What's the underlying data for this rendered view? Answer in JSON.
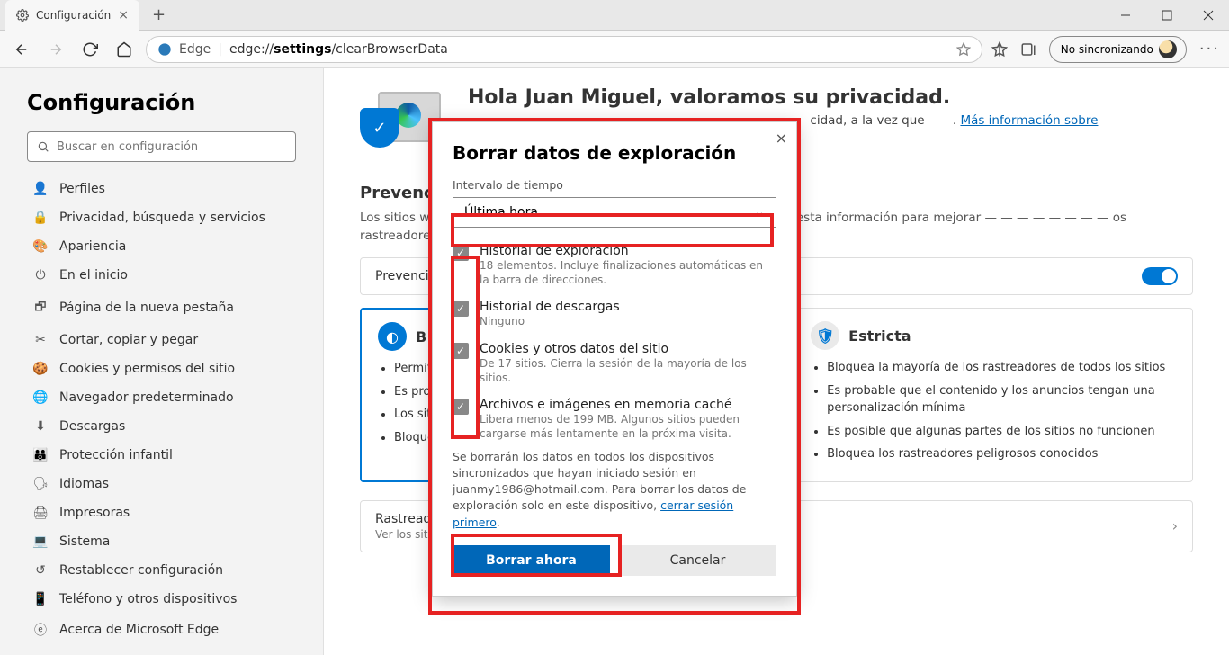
{
  "tab": {
    "title": "Configuración"
  },
  "toolbar": {
    "browser_label": "Edge",
    "url_prefix": "edge://",
    "url_mid": "settings",
    "url_rest": "/clearBrowserData",
    "sync_label": "No sincronizando"
  },
  "sidebar": {
    "title": "Configuración",
    "search_placeholder": "Buscar en configuración",
    "items": [
      {
        "label": "Perfiles"
      },
      {
        "label": "Privacidad, búsqueda y servicios"
      },
      {
        "label": "Apariencia"
      },
      {
        "label": "En el inicio"
      },
      {
        "label": "Página de la nueva pestaña"
      },
      {
        "label": "Cortar, copiar y pegar"
      },
      {
        "label": "Cookies y permisos del sitio"
      },
      {
        "label": "Navegador predeterminado"
      },
      {
        "label": "Descargas"
      },
      {
        "label": "Protección infantil"
      },
      {
        "label": "Idiomas"
      },
      {
        "label": "Impresoras"
      },
      {
        "label": "Sistema"
      },
      {
        "label": "Restablecer configuración"
      },
      {
        "label": "Teléfono y otros dispositivos"
      },
      {
        "label": "Acerca de Microsoft Edge"
      }
    ]
  },
  "main": {
    "hero_title": "Hola Juan Miguel, valoramos su privacidad.",
    "hero_sub_pre": "—— —— — ————— —— ———— —— ——— — ——— cidad, a la vez que",
    "hero_sub_link": "Más información sobre",
    "prevention_h": "Prevención",
    "prevention_desc": "Los sitios web —— — — — — — — — — ón. Los sitios web pueden usar esta información para mejorar — — — — — — — — os rastreadores recopilan y envían su información a sitios que no —",
    "prev_row_label": "Prevención de",
    "card_basic": {
      "title": "B",
      "items": [
        "Permiti — — — rastrear —",
        "Es prob — — — anunci —",
        "Los sit — — — previst —",
        "Bloque — — — conocid —"
      ]
    },
    "card_strict": {
      "title": "Estricta",
      "items": [
        "Bloquea la mayoría de los rastreadores de todos los sitios",
        "Es probable que el contenido y los anuncios tengan una personalización mínima",
        "Es posible que algunas partes de los sitios no funcionen",
        "Bloquea los rastreadores peligrosos conocidos"
      ]
    },
    "blocked_h": "Rastreadores bloqueados",
    "blocked_desc": "Ver los sitios que han sido bloqueados para realizar un seguimiento de usted"
  },
  "dialog": {
    "title": "Borrar datos de exploración",
    "range_label": "Intervalo de tiempo",
    "range_value": "Última hora",
    "items": [
      {
        "title": "Historial de exploración",
        "desc": "18 elementos. Incluye finalizaciones automáticas en la barra de direcciones."
      },
      {
        "title": "Historial de descargas",
        "desc": "Ninguno"
      },
      {
        "title": "Cookies y otros datos del sitio",
        "desc": "De 17 sitios. Cierra la sesión de la mayoría de los sitios."
      },
      {
        "title": "Archivos e imágenes en memoria caché",
        "desc": "Libera menos de 199 MB. Algunos sitios pueden cargarse más lentamente en la próxima visita."
      }
    ],
    "note_pre": "Se borrarán los datos en todos los dispositivos sincronizados que hayan iniciado sesión en juanmy1986@hotmail.com. Para borrar los datos de exploración solo en este dispositivo, ",
    "note_link": "cerrar sesión primero",
    "btn_primary": "Borrar ahora",
    "btn_secondary": "Cancelar"
  }
}
